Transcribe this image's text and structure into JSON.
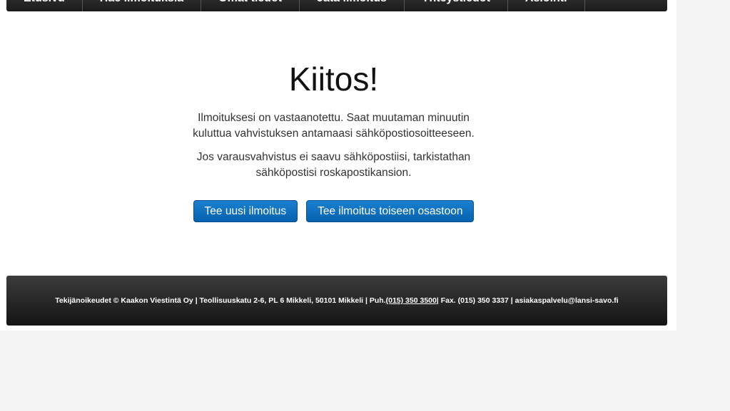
{
  "nav": {
    "items": [
      {
        "label": "Etusivu"
      },
      {
        "label": "Hae ilmoituksia"
      },
      {
        "label": "Omat tiedot"
      },
      {
        "label": "Jätä ilmoitus"
      },
      {
        "label": "Yhteystiedot"
      },
      {
        "label": "Asiointi"
      }
    ]
  },
  "main": {
    "title": "Kiitos!",
    "para1_line1": "Ilmoituksesi on vastaanotettu. Saat muutaman minuutin",
    "para1_line2": "kuluttua vahvistuksen antamaasi sähköpostiosoitteeseen.",
    "para2_line1": "Jos varausvahvistus ei saavu sähköpostiisi, tarkistathan",
    "para2_line2": "sähköpostisi roskapostikansion.",
    "button_new": "Tee uusi ilmoitus",
    "button_other": "Tee ilmoitus toiseen osastoon"
  },
  "footer": {
    "text_before": "Tekijänoikeudet © Kaakon Viestintä Oy | Teollisuuskatu 2-6, PL 6 Mikkeli, 50101 Mikkeli | Puh. ",
    "phone": "(015) 350 3500",
    "text_after": " | Fax. (015) 350 3337 | asiakaspalvelu@lansi-savo.fi"
  },
  "colors": {
    "button_blue": "#0a6cbc",
    "footer_dark": "#222222"
  }
}
